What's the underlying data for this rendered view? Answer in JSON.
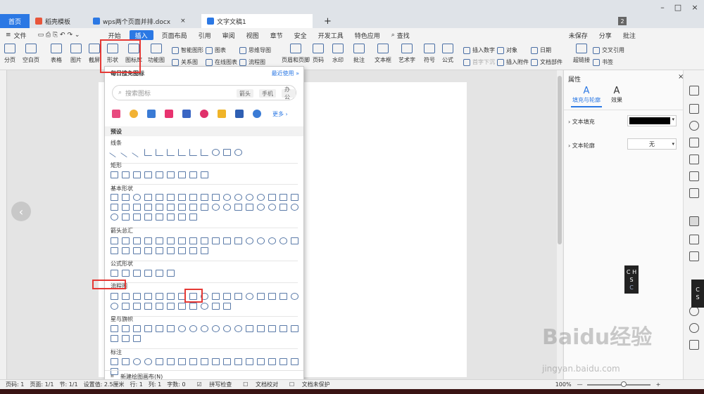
{
  "tabs": {
    "home": "首页",
    "t1": "稻壳模板",
    "t2": "wps两个页面并排.docx",
    "t3": "文字文稿1",
    "add": "+",
    "badge": "2"
  },
  "menu": {
    "file": "文件",
    "items": [
      "开始",
      "插入",
      "页面布局",
      "引用",
      "审阅",
      "视图",
      "章节",
      "安全",
      "开发工具",
      "特色应用",
      "查找"
    ],
    "unsaved": "未保存",
    "share": "分享",
    "annotate": "批注"
  },
  "ribbon": {
    "pagebreak": "分页",
    "blankpage": "空白页",
    "table": "表格",
    "picture": "图片",
    "screenshot": "截屏",
    "shapes": "形状",
    "iconlib": "图标库",
    "funcchart": "功能图",
    "smartart": "智能图形",
    "chart": "图表",
    "mindmap": "思维导图",
    "relation": "关系图",
    "onlinechart": "在线图表",
    "flowchart": "流程图",
    "headerfooter": "页眉和页脚",
    "pagenum": "页码",
    "watermark": "水印",
    "comment": "批注",
    "textbox": "文本框",
    "wordart": "艺术字",
    "symbol": "符号",
    "formula": "公式",
    "insertnum": "插入数字",
    "object": "对象",
    "date": "日期",
    "insertattach": "插入附件",
    "docpart": "文档部件",
    "dropcap": "首字下沉",
    "hyperlink": "超链接",
    "crossref": "交叉引用",
    "bookmark": "书签"
  },
  "dropdown": {
    "title": "每日搜免图标",
    "recent": "最近使用",
    "search_placeholder": "搜索图标",
    "chips": [
      "箭头",
      "手机",
      "办公"
    ],
    "more": "更多",
    "preset": "预设",
    "categories": [
      "线条",
      "矩形",
      "基本形状",
      "箭头总汇",
      "公式形状",
      "流程图",
      "星与旗帜",
      "标注"
    ],
    "footer": "新建绘图画布(N)",
    "icon_colors": [
      "#e84a7f",
      "#f2b234",
      "#3a7bd5",
      "#e8336f",
      "#3a66c4",
      "#e0306a",
      "#f0b428",
      "#2f5fb3",
      "#3a7bd5"
    ]
  },
  "panel": {
    "title": "属性",
    "tab1": "填充与轮廓",
    "tab2": "效果",
    "fill_label": "文本填充",
    "outline_label": "文本轮廓",
    "outline_value": "无"
  },
  "status": {
    "pagenum": "页码: 1",
    "page": "页面: 1/1",
    "section": "节: 1/1",
    "setting": "设置值: 2.5厘米",
    "row": "行: 1",
    "col": "列: 1",
    "words": "字数: 0",
    "spell": "拼写检查",
    "proof": "文档校对",
    "protect": "文档未保护",
    "zoom": "100%"
  },
  "chs": [
    "C",
    "H",
    "S",
    "C"
  ],
  "watermark": {
    "logo": "Baidu经验",
    "url": "jingyan.baidu.com"
  }
}
